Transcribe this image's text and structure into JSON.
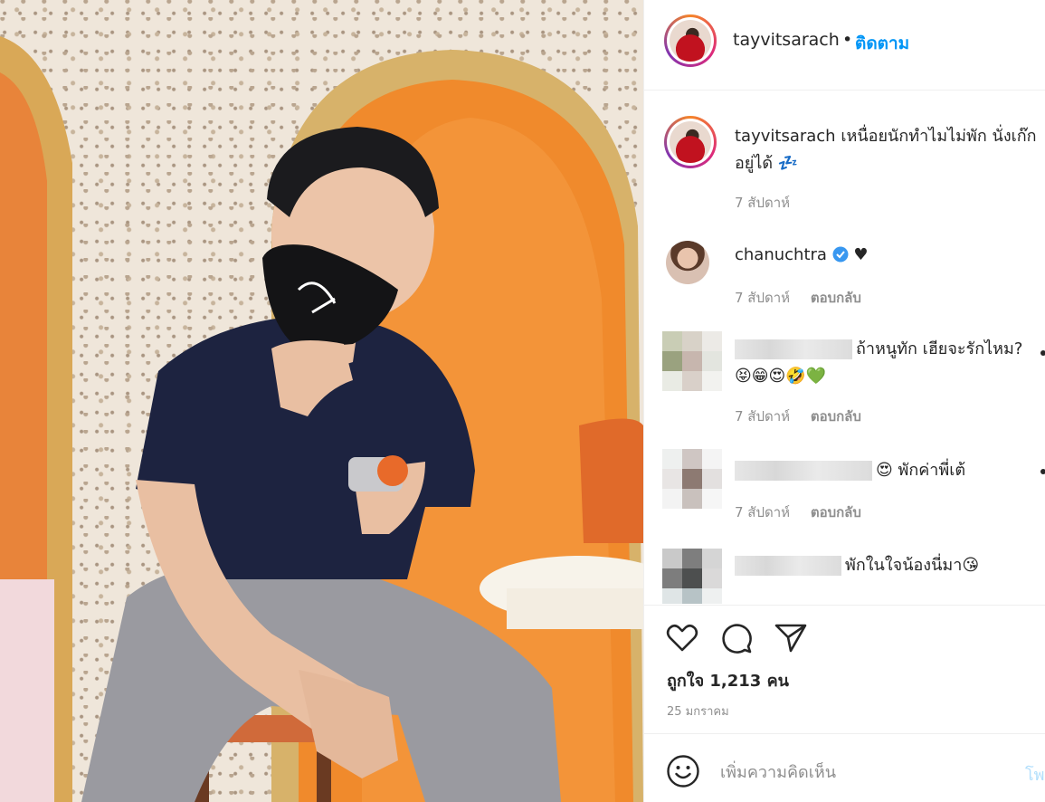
{
  "header": {
    "username": "tayvitsarach",
    "dot": "•",
    "follow_label": "ติดตาม"
  },
  "caption": {
    "username": "tayvitsarach",
    "text": "เหนื่อยนักทำไมไม่พัก นั่งเก๊กอยู่ได้ 💤",
    "time": "7 สัปดาห์"
  },
  "comments": [
    {
      "username": "chanuchtra",
      "verified": true,
      "text": "♥",
      "time": "7 สัปดาห์",
      "reply_label": "ตอบกลับ"
    },
    {
      "username_hidden": true,
      "text": "ถ้าหนูทัก เฮียจะรักไหม? 😝😁😍🤣💚",
      "time": "7 สัปดาห์",
      "reply_label": "ตอบกลับ"
    },
    {
      "username_hidden": true,
      "text": "😍 พักค่าพี่เต้",
      "time": "7 สัปดาห์",
      "reply_label": "ตอบกลับ"
    },
    {
      "username_hidden": true,
      "text": "พักในใจน้องนี่มา😘",
      "time": "",
      "reply_label": ""
    }
  ],
  "actions": {
    "like_icon": "heart-icon",
    "comment_icon": "comment-icon",
    "share_icon": "share-icon",
    "likes_text": "ถูกใจ 1,213 คน",
    "post_date": "25 มกราคม"
  },
  "add_comment": {
    "placeholder": "เพิ่มความคิดเห็น",
    "post_label": "โพสต์"
  },
  "colors": {
    "accent": "#0095f6",
    "text": "#262626",
    "muted": "#8e8e8e",
    "verified": "#3897f0"
  }
}
